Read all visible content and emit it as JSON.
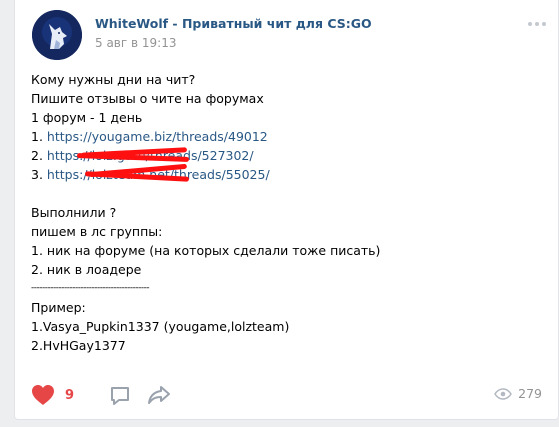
{
  "post": {
    "author": "WhiteWolf - Приватный чит для CS:GO",
    "date": "5 авг в 19:13",
    "lines": [
      "Кому нужны дни на чит?",
      "Пишите отзывы о чите на форумах",
      "1 форум - 1 день",
      "Выполнили ?",
      "пишем в лс группы:",
      "1. ник на форуме (на которых сделали тоже писать)",
      "2. ник в лоадере",
      "-------------------------------------------",
      "Пример:",
      "1.Vasya_Pupkin1337 (yougame,lolzteam)",
      "2.HvHGay1377"
    ],
    "link1": {
      "prefix": "1. ",
      "url": "https://yougame.biz/threads/49012"
    },
    "link2": {
      "prefix": "2. ",
      "url": "https://lolz.guru/threads/527302/"
    },
    "link3": {
      "prefix": "3. ",
      "url": "https://lolzteam.net/threads/55025/"
    }
  },
  "footer": {
    "likes": "9",
    "views": "279"
  },
  "icons": {
    "like": "heart-icon",
    "comment": "comment-icon",
    "share": "share-icon",
    "views": "eye-icon",
    "more": "more-icon"
  },
  "colors": {
    "link": "#2a5885",
    "like": "#e64646",
    "redaction": "#ff1010"
  }
}
